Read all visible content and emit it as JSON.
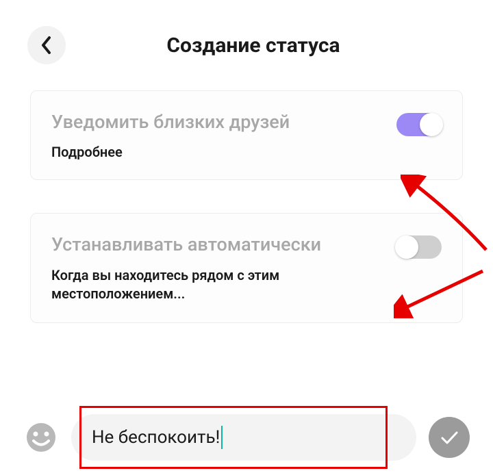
{
  "header": {
    "title": "Создание статуса"
  },
  "cards": {
    "notify": {
      "title": "Уведомить близких друзей",
      "sub": "Подробнее",
      "toggle_on": true
    },
    "auto": {
      "title": "Устанавливать автоматически",
      "desc": "Когда вы находитесь рядом с этим местоположением...",
      "toggle_on": false
    }
  },
  "input": {
    "value": "Не беспокоить!"
  }
}
